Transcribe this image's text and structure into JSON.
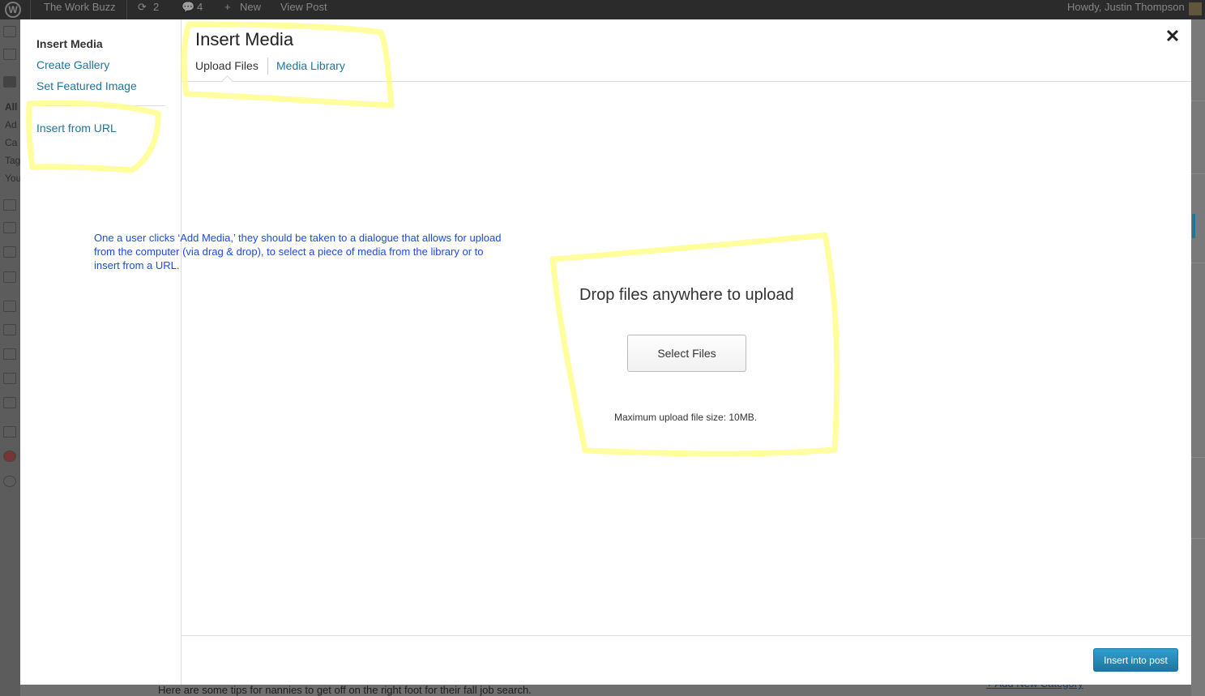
{
  "admin_bar": {
    "site_name": "The Work Buzz",
    "updates_count": "2",
    "comments_count": "4",
    "new_label": "New",
    "view_post_label": "View Post",
    "greeting": "Howdy, Justin Thompson"
  },
  "admin_menu_partial": [
    "All",
    "Ad",
    "Ca",
    "Tag",
    "You"
  ],
  "modal": {
    "sidebar": {
      "items": [
        {
          "label": "Insert Media",
          "active": true
        },
        {
          "label": "Create Gallery",
          "active": false
        },
        {
          "label": "Set Featured Image",
          "active": false
        },
        {
          "label": "Insert from URL",
          "active": false
        }
      ]
    },
    "title": "Insert Media",
    "tabs": [
      {
        "label": "Upload Files",
        "active": true
      },
      {
        "label": "Media Library",
        "active": false
      }
    ],
    "close_icon": "close-icon",
    "uploader": {
      "drop_text": "Drop files anywhere to upload",
      "select_button": "Select Files",
      "max_size": "Maximum upload file size: 10MB."
    },
    "insert_button": "Insert into post"
  },
  "annotation": "One a user clicks ‘Add Media,’ they should be taken to a dialogue that allows for upload from the computer (via drag & drop), to select a piece of media from the library or to insert from a URL.",
  "background_page": {
    "post_excerpt": "Here are some tips for nannies to get off on the right foot for their fall job search.",
    "add_category_link": "+ Add New Category"
  },
  "colors": {
    "link": "#21759b",
    "primary_button": "#21759b",
    "highlight": "#ffff8c",
    "annotation_text": "#1f4be0",
    "admin_bar": "#2b2b2b"
  }
}
